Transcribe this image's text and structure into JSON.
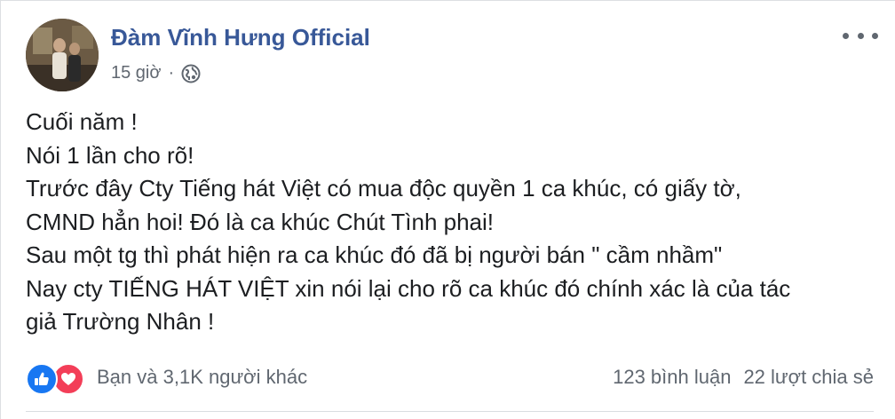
{
  "post": {
    "author": "Đàm Vĩnh Hưng Official",
    "timestamp": "15 giờ",
    "separator": "·",
    "privacy_icon": "globe-icon",
    "more_icon": "more-options-icon",
    "lines": [
      "Cuối năm !",
      "Nói 1 lần cho rõ!",
      "Trước đây Cty Tiếng hát Việt có mua độc quyền 1 ca khúc, có giấy tờ,",
      "CMND hẳn hoi! Đó là ca khúc Chút Tình phai!",
      "Sau một tg thì phát hiện ra ca khúc đó đã bị người bán \" cầm nhầm\"",
      "Nay cty TIẾNG HÁT VIỆT xin nói lại cho rõ ca khúc đó chính xác là của tác",
      "giả Trường Nhân !"
    ]
  },
  "footer": {
    "reaction_icons": [
      "like-icon",
      "love-icon"
    ],
    "reactions_text": "Bạn và 3,1K người khác",
    "comments": "123 bình luận",
    "shares": "22 lượt chia sẻ"
  },
  "colors": {
    "author": "#385898",
    "like": "#1877f2",
    "love": "#f33e58",
    "secondary_text": "#606770",
    "body_text": "#1c1e21"
  }
}
